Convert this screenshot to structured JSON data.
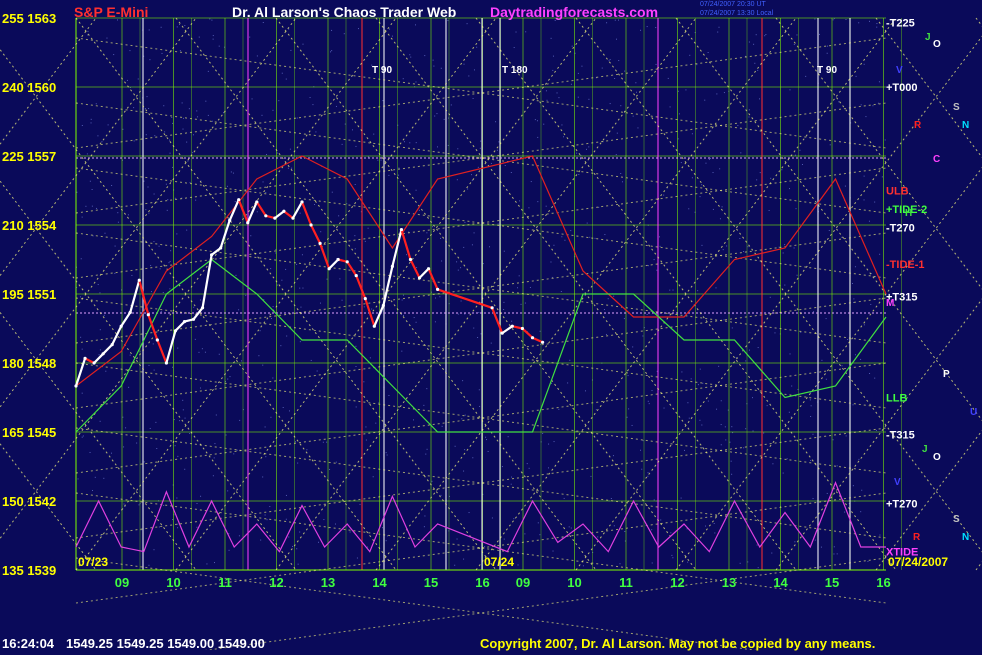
{
  "header": {
    "symbol": "S&P E-Mini",
    "title": "Dr. Al Larson's Chaos Trader Web",
    "site": "Daytradingforecasts.com",
    "stamp_ut": "07/24/2007 20:30 UT",
    "stamp_local": "07/24/2007 13:30 Local"
  },
  "footer": {
    "time": "16:24:04",
    "ohlc": "1549.25 1549.25 1549.00 1549.00",
    "copyright": "Copyright 2007, Dr. Al Larson. May not be copied by any means."
  },
  "colors": {
    "background": "#0a0a5a",
    "price_up": "#ffffff",
    "price_down": "#ff2020",
    "grid_lines": "#7fff00",
    "diagonals": "#ffff80",
    "red_curve": "#e02020",
    "green_curve": "#40e040",
    "magenta_curve": "#e040e0"
  },
  "chart_data": {
    "type": "line",
    "title": "S&P E-Mini",
    "left_axis_labels": [
      "255 1563",
      "240 1560",
      "225 1557",
      "210 1554",
      "195 1551",
      "180 1548",
      "165 1545",
      "150 1542",
      "135 1539"
    ],
    "left_axis_prices": [
      1563,
      1560,
      1557,
      1554,
      1551,
      1548,
      1545,
      1542,
      1539
    ],
    "ylim": [
      1539,
      1563
    ],
    "x_tick_labels": [
      "09",
      "10",
      "11",
      "12",
      "13",
      "14",
      "15",
      "16",
      "09",
      "10",
      "11",
      "12",
      "13",
      "14",
      "15",
      "16"
    ],
    "dates": {
      "start": "07/23",
      "mid": "07/24",
      "end": "07/24/2007"
    },
    "right_labels": [
      {
        "text": "-T225",
        "price": 1562.8,
        "color": "#ffffff"
      },
      {
        "text": "+T000",
        "price": 1560.0,
        "color": "#ffffff"
      },
      {
        "text": "ULB",
        "price": 1555.5,
        "color": "#ff3030"
      },
      {
        "text": "+TIDE-2",
        "price": 1554.7,
        "color": "#40ff40"
      },
      {
        "text": "-T270",
        "price": 1553.9,
        "color": "#ffffff"
      },
      {
        "text": "-TIDE-1",
        "price": 1552.3,
        "color": "#ff3030"
      },
      {
        "text": "+T315",
        "price": 1550.9,
        "color": "#ffffff"
      },
      {
        "text": "LLB",
        "price": 1546.5,
        "color": "#40ff40"
      },
      {
        "text": "-T315",
        "price": 1544.9,
        "color": "#ffffff"
      },
      {
        "text": "+T270",
        "price": 1541.9,
        "color": "#ffffff"
      },
      {
        "text": "XTIDE",
        "price": 1539.8,
        "color": "#ff40ff"
      }
    ],
    "planet_labels": [
      {
        "text": "J",
        "color": "#40e040"
      },
      {
        "text": "O",
        "color": "#ffffff"
      },
      {
        "text": "V",
        "color": "#4040ff"
      },
      {
        "text": "S",
        "color": "#c0c0c0"
      },
      {
        "text": "N",
        "color": "#00e0ff"
      },
      {
        "text": "R",
        "color": "#ff2020"
      },
      {
        "text": "C",
        "color": "#ff40ff"
      },
      {
        "text": "H",
        "color": "#40e040"
      },
      {
        "text": "M",
        "color": "#ff40ff"
      },
      {
        "text": "P",
        "color": "#ffffff"
      },
      {
        "text": "U",
        "color": "#4040ff"
      },
      {
        "text": "J",
        "color": "#40e040"
      },
      {
        "text": "O",
        "color": "#ffffff"
      },
      {
        "text": "V",
        "color": "#4040ff"
      },
      {
        "text": "S",
        "color": "#c0c0c0"
      },
      {
        "text": "N",
        "color": "#00e0ff"
      },
      {
        "text": "R",
        "color": "#ff2020"
      }
    ],
    "markers": [
      {
        "text": "T 90",
        "color": "#ffffff"
      },
      {
        "text": "T 180",
        "color": "#ffffff"
      },
      {
        "text": "T 90",
        "color": "#ffffff"
      }
    ],
    "price_series": {
      "name": "",
      "points": [
        [
          0.0,
          1547
        ],
        [
          0.2,
          1548.2
        ],
        [
          0.4,
          1548.0
        ],
        [
          0.6,
          1548.4
        ],
        [
          0.8,
          1548.8
        ],
        [
          1.0,
          1549.6
        ],
        [
          1.2,
          1550.2
        ],
        [
          1.4,
          1551.6
        ],
        [
          1.6,
          1550.1
        ],
        [
          1.8,
          1549.0
        ],
        [
          2.0,
          1548.0
        ],
        [
          2.2,
          1549.4
        ],
        [
          2.4,
          1549.8
        ],
        [
          2.6,
          1549.9
        ],
        [
          2.8,
          1550.4
        ],
        [
          3.0,
          1552.7
        ],
        [
          3.2,
          1553.0
        ],
        [
          3.4,
          1554.2
        ],
        [
          3.6,
          1555.1
        ],
        [
          3.8,
          1554.1
        ],
        [
          4.0,
          1555.0
        ],
        [
          4.2,
          1554.4
        ],
        [
          4.4,
          1554.3
        ],
        [
          4.6,
          1554.6
        ],
        [
          4.8,
          1554.3
        ],
        [
          5.0,
          1555.0
        ],
        [
          5.2,
          1554.0
        ],
        [
          5.4,
          1553.2
        ],
        [
          5.6,
          1552.1
        ],
        [
          5.8,
          1552.5
        ],
        [
          6.0,
          1552.4
        ],
        [
          6.2,
          1551.8
        ],
        [
          6.4,
          1550.8
        ],
        [
          6.6,
          1549.6
        ],
        [
          6.8,
          1550.5
        ],
        [
          7.0,
          1552.2
        ],
        [
          7.2,
          1553.8
        ],
        [
          7.4,
          1552.5
        ],
        [
          7.6,
          1551.7
        ],
        [
          7.8,
          1552.1
        ],
        [
          8.0,
          1551.2
        ],
        [
          8.2,
          1550.4
        ],
        [
          8.4,
          1549.3
        ],
        [
          8.6,
          1549.6
        ],
        [
          8.8,
          1549.5
        ],
        [
          9.0,
          1549.1
        ],
        [
          9.2,
          1548.9
        ]
      ]
    },
    "red_curve": [
      [
        0,
        1547
      ],
      [
        1,
        1548.5
      ],
      [
        2,
        1552
      ],
      [
        3,
        1553.5
      ],
      [
        4,
        1556
      ],
      [
        5,
        1557
      ],
      [
        6,
        1556
      ],
      [
        7,
        1553
      ],
      [
        8,
        1556
      ],
      [
        9,
        1557
      ],
      [
        10,
        1552
      ],
      [
        11,
        1550
      ],
      [
        12,
        1550
      ],
      [
        13,
        1552.5
      ],
      [
        14,
        1553
      ],
      [
        15,
        1556
      ],
      [
        16,
        1551
      ]
    ],
    "green_curve": [
      [
        0,
        1545
      ],
      [
        1,
        1547
      ],
      [
        2,
        1551
      ],
      [
        3,
        1552.5
      ],
      [
        4,
        1551
      ],
      [
        5,
        1549
      ],
      [
        6,
        1549
      ],
      [
        7,
        1547
      ],
      [
        8,
        1545
      ],
      [
        9,
        1545
      ],
      [
        10,
        1551
      ],
      [
        11,
        1551
      ],
      [
        12,
        1549
      ],
      [
        13,
        1549
      ],
      [
        14,
        1546.5
      ],
      [
        15,
        1547
      ],
      [
        16,
        1550
      ]
    ],
    "magenta_curve": [
      [
        0,
        1540
      ],
      [
        0.5,
        1542
      ],
      [
        1,
        1540
      ],
      [
        1.5,
        1539.8
      ],
      [
        2,
        1542.4
      ],
      [
        2.5,
        1540
      ],
      [
        3,
        1542
      ],
      [
        3.5,
        1540
      ],
      [
        4,
        1541
      ],
      [
        4.5,
        1539.8
      ],
      [
        5,
        1541.8
      ],
      [
        5.5,
        1540
      ],
      [
        6,
        1541
      ],
      [
        6.5,
        1539.8
      ],
      [
        7,
        1542.2
      ],
      [
        7.5,
        1540
      ],
      [
        8,
        1541
      ],
      [
        8.5,
        1539.8
      ],
      [
        9,
        1542
      ],
      [
        9.5,
        1540.2
      ],
      [
        10,
        1541
      ],
      [
        10.5,
        1539.8
      ],
      [
        11,
        1542
      ],
      [
        11.5,
        1540
      ],
      [
        12,
        1541
      ],
      [
        12.5,
        1539.8
      ],
      [
        13,
        1542
      ],
      [
        13.5,
        1540
      ],
      [
        14,
        1541.5
      ],
      [
        14.5,
        1540
      ],
      [
        15,
        1542.8
      ],
      [
        15.5,
        1540
      ],
      [
        16,
        1540
      ]
    ],
    "grid": true
  }
}
